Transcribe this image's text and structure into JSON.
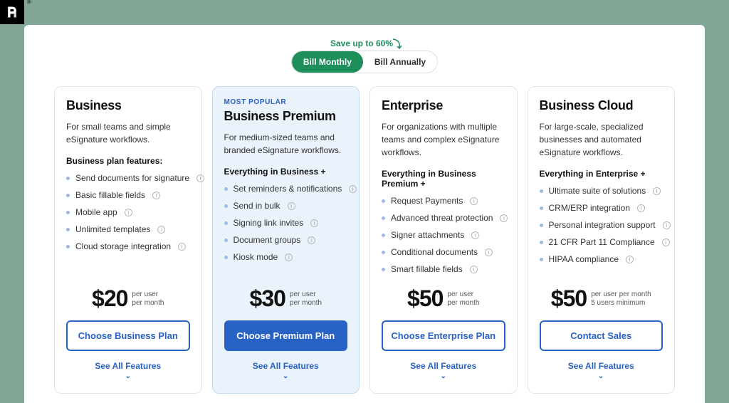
{
  "promo": {
    "save_text": "Save up to 60%"
  },
  "billing_toggle": {
    "monthly": "Bill Monthly",
    "annually": "Bill Annually"
  },
  "plans": [
    {
      "badge": "",
      "name": "Business",
      "desc": "For small teams and simple eSignature workflows.",
      "feat_head": "Business plan features:",
      "features": [
        "Send documents for signature",
        "Basic fillable fields",
        "Mobile app",
        "Unlimited templates",
        "Cloud storage integration"
      ],
      "price": "$20",
      "per_line1": "per user",
      "per_line2": "per month",
      "cta": "Choose Business Plan",
      "see_all": "See All Features"
    },
    {
      "badge": "MOST POPULAR",
      "name": "Business Premium",
      "desc": "For medium-sized teams and branded eSignature workflows.",
      "feat_head": "Everything in Business +",
      "features": [
        "Set reminders & notifications",
        "Send in bulk",
        "Signing link invites",
        "Document groups",
        "Kiosk mode"
      ],
      "price": "$30",
      "per_line1": "per user",
      "per_line2": "per month",
      "cta": "Choose Premium Plan",
      "see_all": "See All Features"
    },
    {
      "badge": "",
      "name": "Enterprise",
      "desc": "For organizations with multiple teams and complex eSignature workflows.",
      "feat_head": "Everything in Business Premium +",
      "features": [
        "Request Payments",
        "Advanced threat protection",
        "Signer attachments",
        "Conditional documents",
        "Smart fillable fields"
      ],
      "price": "$50",
      "per_line1": "per user",
      "per_line2": "per month",
      "cta": "Choose Enterprise Plan",
      "see_all": "See All Features"
    },
    {
      "badge": "",
      "name": "Business Cloud",
      "desc": "For large-scale, specialized businesses and automated eSignature workflows.",
      "feat_head": "Everything in Enterprise +",
      "features": [
        "Ultimate suite of solutions",
        "CRM/ERP integration",
        "Personal integration support",
        "21 CFR Part 11 Compliance",
        "HIPAA compliance"
      ],
      "price": "$50",
      "per_line1": "per user per month",
      "per_line2": "5 users minimum",
      "cta": "Contact Sales",
      "see_all": "See All Features"
    }
  ]
}
